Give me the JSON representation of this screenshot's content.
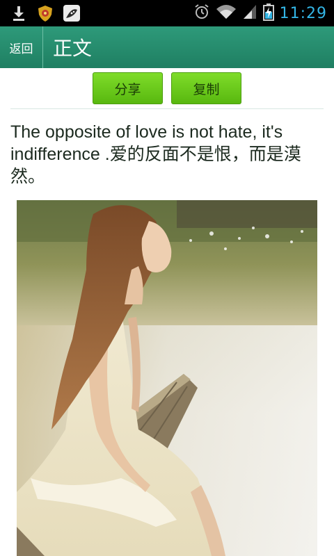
{
  "status_bar": {
    "time": "11:29",
    "icons": [
      "download-icon",
      "shield-app-icon",
      "watermelon-app-icon",
      "alarm-icon",
      "wifi-icon",
      "signal-icon",
      "battery-charging-icon"
    ],
    "time_color": "#33b5e5"
  },
  "header": {
    "back_label": "返回",
    "title": "正文",
    "bg_color": "#2a8f70"
  },
  "actions": {
    "share_label": "分享",
    "copy_label": "复制",
    "button_color": "#6bcc1f"
  },
  "article": {
    "text": "The opposite of love is not hate, it's indifference .爱的反面不是恨，而是漠然。"
  },
  "image": {
    "description_icon": "photo-woman-by-lake"
  }
}
